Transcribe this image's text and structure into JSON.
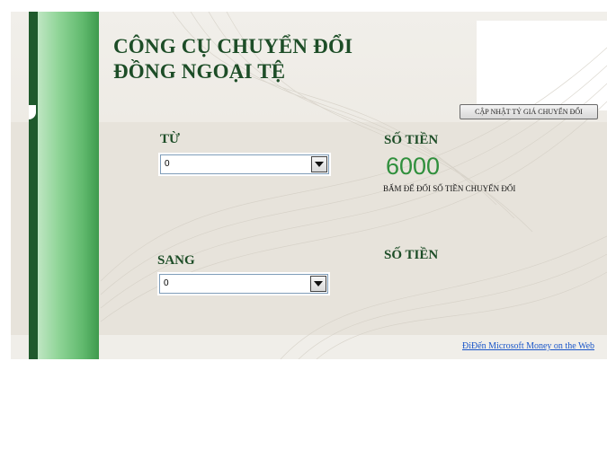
{
  "title_line1": "CÔNG CỤ CHUYỂN ĐỔI",
  "title_line2": "ĐỒNG NGOẠI TỆ",
  "update_button": "CẬP NHẬT TỶ GIÁ CHUYỂN ĐỔI",
  "from": {
    "label": "TỪ",
    "selected": "0"
  },
  "to": {
    "label": "SANG",
    "selected": "0"
  },
  "amount": {
    "label": "SỐ TIỀN",
    "value": "6000",
    "hint": "BẤM ĐỂ ĐỔI SỐ TIỀN CHUYỂN ĐỔI"
  },
  "result": {
    "label": "SỐ TIỀN"
  },
  "footer_link": "ĐiĐến Microsoft Money on the Web",
  "colors": {
    "title_green": "#1d4d27",
    "amount_green": "#2f8f3c",
    "bar_dark": "#1f5a2c",
    "link_blue": "#1a56c9"
  },
  "icons": {
    "dropdown": "chevron-down-icon"
  }
}
